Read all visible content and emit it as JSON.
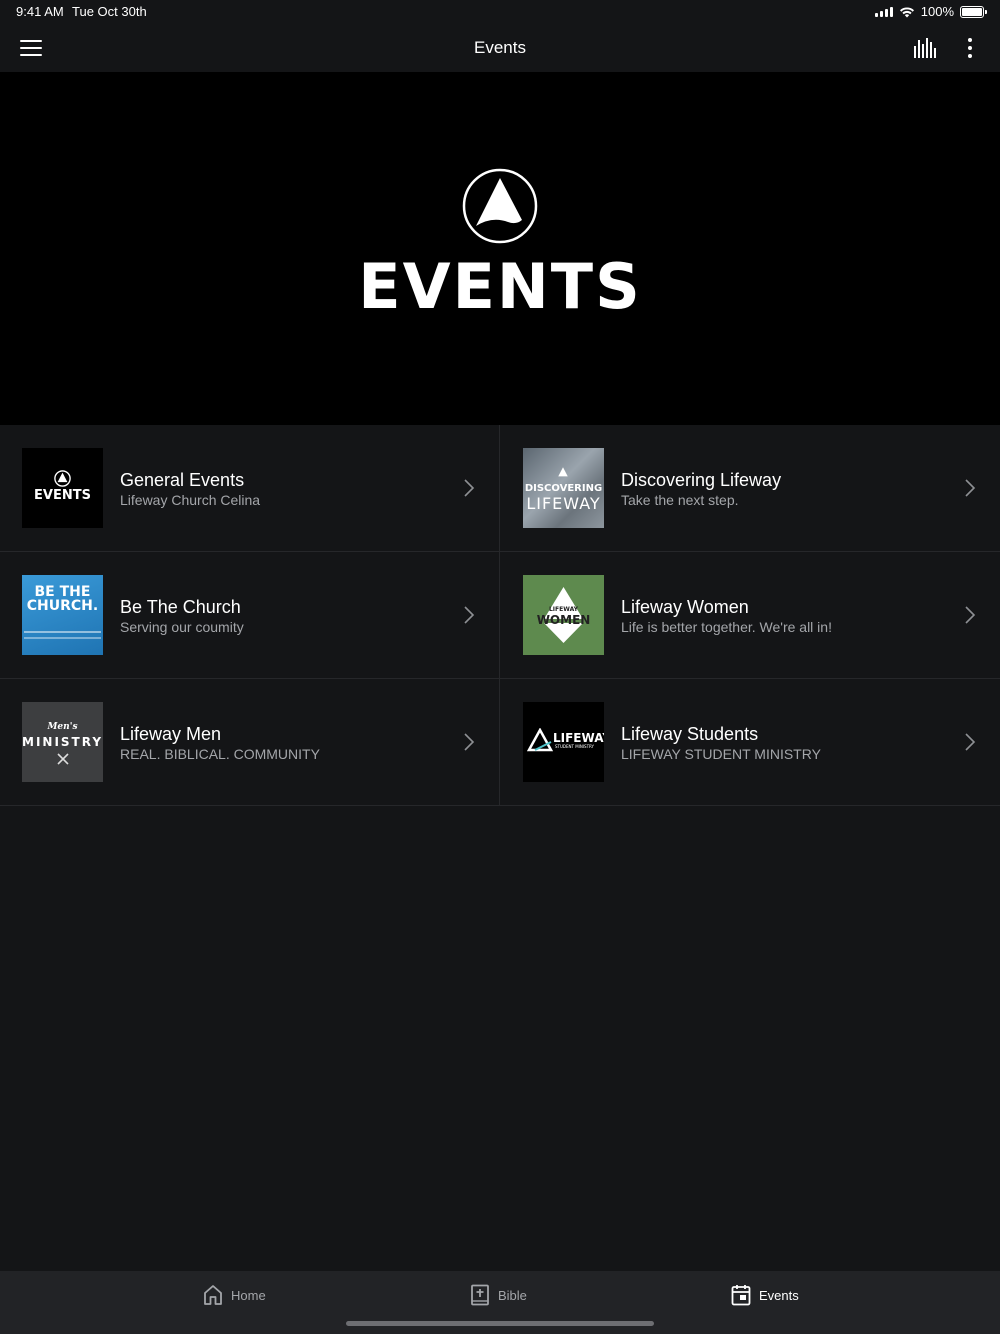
{
  "status_bar": {
    "time": "9:41 AM",
    "date": "Tue Oct 30th",
    "battery": "100%"
  },
  "nav": {
    "title": "Events"
  },
  "hero": {
    "text": "EVENTS"
  },
  "items": [
    {
      "title": "General Events",
      "subtitle": "Lifeway Church Celina",
      "thumb_text": "EVENTS"
    },
    {
      "title": "Discovering Lifeway",
      "subtitle": "Take the next step.",
      "thumb_text_1": "DISCOVERING",
      "thumb_text_2": "LIFEWAY"
    },
    {
      "title": "Be The Church",
      "subtitle": "Serving our coumity",
      "thumb_text": "BE THE CHURCH."
    },
    {
      "title": "Lifeway Women",
      "subtitle": "Life is better together. We're all in!",
      "thumb_text_1": "LIFEWAY",
      "thumb_text_2": "WOMEN"
    },
    {
      "title": "Lifeway Men",
      "subtitle": "REAL. BIBLICAL. COMMUNITY",
      "thumb_text_1": "Men's",
      "thumb_text_2": "MINISTRY"
    },
    {
      "title": "Lifeway Students",
      "subtitle": "LIFEWAY STUDENT MINISTRY",
      "thumb_text_1": "LIFEWAY",
      "thumb_text_2": "STUDENT MINISTRY"
    }
  ],
  "tabs": [
    {
      "label": "Home",
      "icon": "home-icon"
    },
    {
      "label": "Bible",
      "icon": "bible-icon"
    },
    {
      "label": "Events",
      "icon": "calendar-icon"
    }
  ],
  "colors": {
    "background": "#141517",
    "tabbar": "#222326",
    "subtitle": "#a4a6aa",
    "women_green": "#5e8a4e",
    "church_blue": "#2a88c9"
  }
}
